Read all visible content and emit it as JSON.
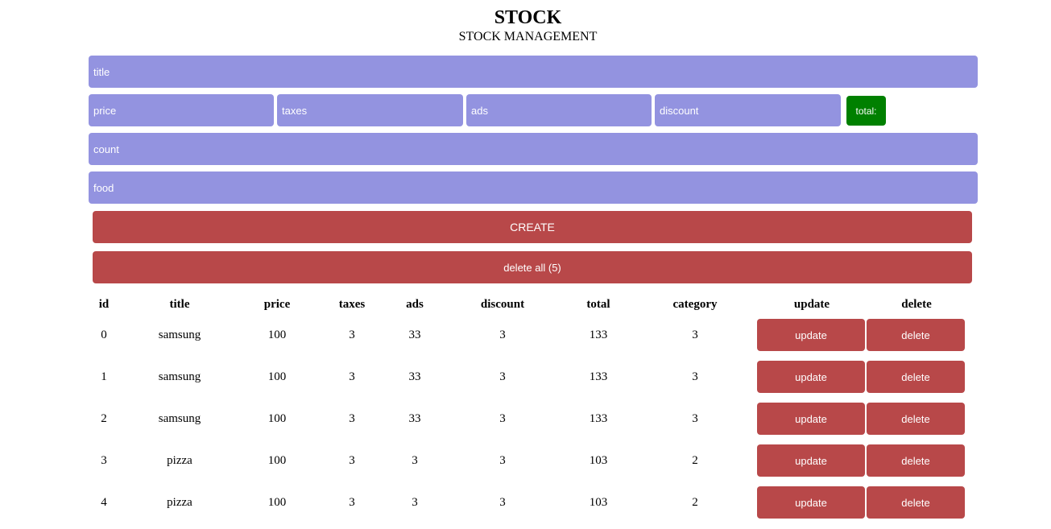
{
  "header": {
    "title": "STOCK",
    "subtitle": "STOCK MANAGEMENT"
  },
  "form": {
    "title_placeholder": "title",
    "price_placeholder": "price",
    "taxes_placeholder": "taxes",
    "ads_placeholder": "ads",
    "discount_placeholder": "discount",
    "total_label": "total:",
    "count_placeholder": "count",
    "category_placeholder": "food",
    "create_label": "CREATE",
    "delete_all_label": "delete all (5)"
  },
  "colors": {
    "input_bg": "#9393e0",
    "button_red": "#b84849",
    "total_green": "#008000"
  },
  "table": {
    "headers": [
      "id",
      "title",
      "price",
      "taxes",
      "ads",
      "discount",
      "total",
      "category",
      "update",
      "delete"
    ],
    "rows": [
      {
        "id": "0",
        "title": "samsung",
        "price": "100",
        "taxes": "3",
        "ads": "33",
        "discount": "3",
        "total": "133",
        "category": "3",
        "update": "update",
        "delete": "delete"
      },
      {
        "id": "1",
        "title": "samsung",
        "price": "100",
        "taxes": "3",
        "ads": "33",
        "discount": "3",
        "total": "133",
        "category": "3",
        "update": "update",
        "delete": "delete"
      },
      {
        "id": "2",
        "title": "samsung",
        "price": "100",
        "taxes": "3",
        "ads": "33",
        "discount": "3",
        "total": "133",
        "category": "3",
        "update": "update",
        "delete": "delete"
      },
      {
        "id": "3",
        "title": "pizza",
        "price": "100",
        "taxes": "3",
        "ads": "3",
        "discount": "3",
        "total": "103",
        "category": "2",
        "update": "update",
        "delete": "delete"
      },
      {
        "id": "4",
        "title": "pizza",
        "price": "100",
        "taxes": "3",
        "ads": "3",
        "discount": "3",
        "total": "103",
        "category": "2",
        "update": "update",
        "delete": "delete"
      }
    ]
  }
}
